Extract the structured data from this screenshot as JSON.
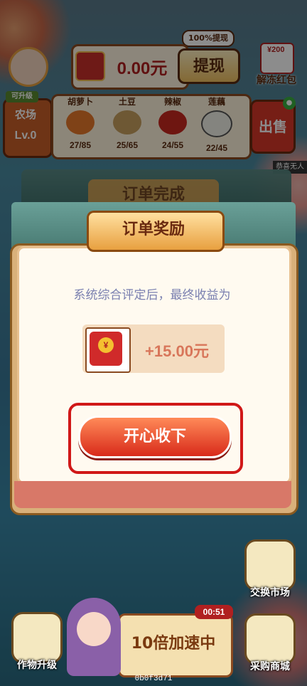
{
  "header": {
    "withdraw_tag": "100%提现",
    "balance": "0.00元",
    "withdraw_label": "提现",
    "unlock_label": "解冻红包",
    "unlock_amount": "¥200"
  },
  "farm": {
    "upgrade_tag": "可升级",
    "name": "农场",
    "level": "Lv.0"
  },
  "crops": [
    {
      "name": "胡萝卜",
      "count": "27/85",
      "color": "#e8782a"
    },
    {
      "name": "土豆",
      "count": "25/65",
      "color": "#c8a060"
    },
    {
      "name": "辣椒",
      "count": "24/55",
      "color": "#c82820"
    },
    {
      "name": "莲藕",
      "count": "22/45",
      "color": "#f0f0e8"
    }
  ],
  "sell_label": "出售",
  "congrats_text": "恭喜无人",
  "background_tab": "订单完成",
  "modal": {
    "title": "订单奖励",
    "description": "系统综合评定后，最终收益为",
    "reward_amount": "+15.00元",
    "accept_label": "开心收下"
  },
  "bottom": {
    "exchange_label": "交换市场",
    "crop_upgrade_label": "作物升级",
    "speed_label": "10倍加速中",
    "timer": "00:51",
    "shop_label": "采购商城",
    "build_id": "0b0f3d71"
  }
}
